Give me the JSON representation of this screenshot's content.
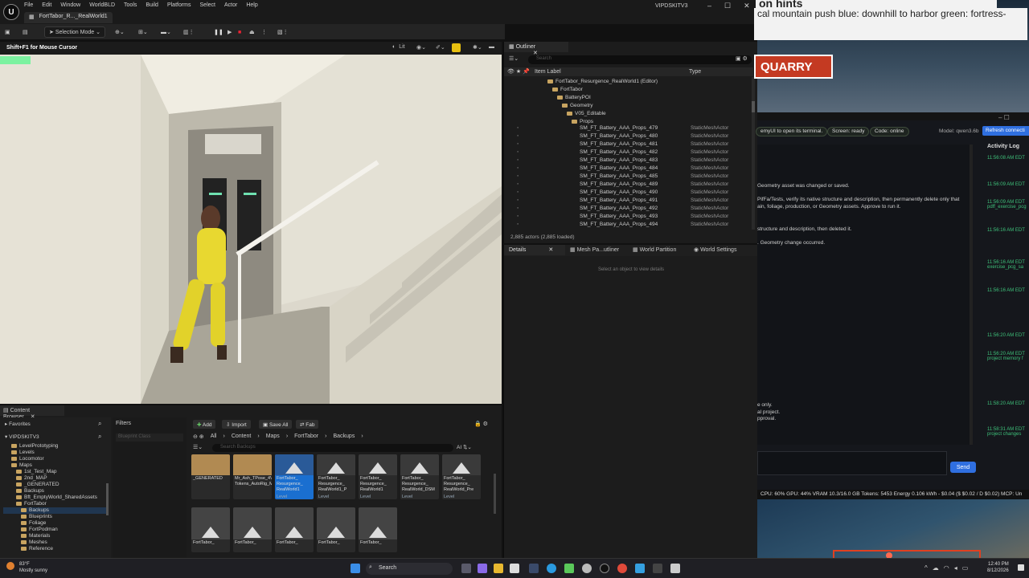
{
  "editor": {
    "menu": [
      "File",
      "Edit",
      "Window",
      "WorldBLD",
      "Tools",
      "Build",
      "Platforms",
      "Select",
      "Actor",
      "Help"
    ],
    "doc_tab": "FortTabor_R..._RealWorld1",
    "window_title": "VIPDSKITV3",
    "selection_mode": "Selection Mode",
    "viewport_hint": "Shift+F1 for Mouse Cursor",
    "viewport_lit": "Lit"
  },
  "outliner": {
    "title": "Outliner",
    "search_placeholder": "Search",
    "col_label": "Item Label",
    "col_type": "Type",
    "tree": [
      {
        "label": "FortTabor_Resurgence_RealWorld1 (Editor)",
        "indent": 52
      },
      {
        "label": "FortTabor",
        "indent": 58
      },
      {
        "label": "BatteryPOI",
        "indent": 64
      },
      {
        "label": "Geometry",
        "indent": 70
      },
      {
        "label": "V05_Editable",
        "indent": 76
      },
      {
        "label": "Props",
        "indent": 82
      }
    ],
    "items": [
      {
        "name": "SM_FT_Battery_AAA_Props_479",
        "type": "StaticMeshActor"
      },
      {
        "name": "SM_FT_Battery_AAA_Props_480",
        "type": "StaticMeshActor"
      },
      {
        "name": "SM_FT_Battery_AAA_Props_481",
        "type": "StaticMeshActor"
      },
      {
        "name": "SM_FT_Battery_AAA_Props_482",
        "type": "StaticMeshActor"
      },
      {
        "name": "SM_FT_Battery_AAA_Props_483",
        "type": "StaticMeshActor"
      },
      {
        "name": "SM_FT_Battery_AAA_Props_484",
        "type": "StaticMeshActor"
      },
      {
        "name": "SM_FT_Battery_AAA_Props_485",
        "type": "StaticMeshActor"
      },
      {
        "name": "SM_FT_Battery_AAA_Props_489",
        "type": "StaticMeshActor"
      },
      {
        "name": "SM_FT_Battery_AAA_Props_490",
        "type": "StaticMeshActor"
      },
      {
        "name": "SM_FT_Battery_AAA_Props_491",
        "type": "StaticMeshActor"
      },
      {
        "name": "SM_FT_Battery_AAA_Props_492",
        "type": "StaticMeshActor"
      },
      {
        "name": "SM_FT_Battery_AAA_Props_493",
        "type": "StaticMeshActor"
      },
      {
        "name": "SM_FT_Battery_AAA_Props_494",
        "type": "StaticMeshActor"
      }
    ],
    "status": "2,885 actors (2,885 loaded)"
  },
  "details": {
    "tabs": [
      "Details",
      "Mesh Pa...utliner",
      "World Partition",
      "World Settings"
    ],
    "empty": "Select an object to view details"
  },
  "content_browser": {
    "title": "Content Browser",
    "favorites": "Favorites",
    "root": "VIPDSKITV3",
    "filters": "Filters",
    "filter_placeholder": "Blueprint Class",
    "buttons": {
      "add": "Add",
      "import": "Import",
      "save_all": "Save All",
      "fab": "Fab"
    },
    "path": [
      "All",
      "Content",
      "Maps",
      "FortTabor",
      "Backups"
    ],
    "search_placeholder": "Search Backups",
    "tree": [
      {
        "label": "LevelPrototyping",
        "indent": 10
      },
      {
        "label": "Levels",
        "indent": 10
      },
      {
        "label": "Locomotor",
        "indent": 10
      },
      {
        "label": "Maps",
        "indent": 10
      },
      {
        "label": "1st_Test_Map",
        "indent": 16
      },
      {
        "label": "2nd_MAP",
        "indent": 16
      },
      {
        "label": "_GENERATED",
        "indent": 16
      },
      {
        "label": "Backups",
        "indent": 16
      },
      {
        "label": "Bft_EmptyWorld_SharedAssets",
        "indent": 16
      },
      {
        "label": "FortTabor",
        "indent": 16
      },
      {
        "label": "Backups",
        "indent": 22
      },
      {
        "label": "Blueprints",
        "indent": 22
      },
      {
        "label": "Foliage",
        "indent": 22
      },
      {
        "label": "FortPodman",
        "indent": 22
      },
      {
        "label": "Materials",
        "indent": 22
      },
      {
        "label": "Meshes",
        "indent": 22
      },
      {
        "label": "Reference",
        "indent": 22
      }
    ],
    "assets_row1": [
      {
        "label": "_GENERATED",
        "kind": "folder"
      },
      {
        "label": "Mr_Ash_TPose_4View_2K_Skin Tokens_AutoRig_Mixamo",
        "kind": "folder"
      },
      {
        "label": "FortTabor_ Resurgence_ RealWorld1",
        "kind": "level",
        "sub": "Level"
      },
      {
        "label": "FortTabor_ Resurgence_ RealWorld1_P",
        "kind": "level",
        "sub": "Level"
      },
      {
        "label": "FortTabor_ Resurgence_ RealWorld1",
        "kind": "level",
        "sub": "Level"
      },
      {
        "label": "FortTabor_ Resurgence_ RealWorld_DSM",
        "kind": "level",
        "sub": "Level"
      },
      {
        "label": "FortTabor_ Resurgence_ RealWorld_Pre",
        "kind": "level",
        "sub": "Level"
      }
    ],
    "assets_row2": [
      "FortTabor_",
      "FortTabor_",
      "FortTabor_",
      "FortTabor_",
      "FortTabor_"
    ]
  },
  "right_panel": {
    "hints_text": "cal mountain push   blue: downhill to harbor   green: fortress-",
    "hints_header": "on hints",
    "quarry": "QUARRY",
    "chips": [
      "emyUI to open its terminal.",
      "Screen: ready",
      "Code: online"
    ],
    "model": "Model: qwen3.6b",
    "refresh": "Refresh connecti",
    "activity_title": "Activity Log",
    "messages": [
      "Geometry asset was changed or saved.",
      "PifFa/Tests, verify its native structure and description, then permanently delete only that",
      "ain, foliage, production, or Geometry assets. Approve to run it.",
      "structure and description, then deleted it.",
      ". Geometry change occurred.",
      "e only.",
      "al project.",
      "pproval."
    ],
    "activity": [
      {
        "time": "11:56:08 AM EDT",
        "text": ""
      },
      {
        "time": "11:56:09 AM EDT",
        "text": ""
      },
      {
        "time": "11:56:09 AM EDT",
        "text": "pdff_exercise_pcg"
      },
      {
        "time": "11:56:16 AM EDT",
        "text": ""
      },
      {
        "time": "11:56:16 AM EDT",
        "text": "exercise_pcg_sa"
      },
      {
        "time": "11:56:16 AM EDT",
        "text": ""
      },
      {
        "time": "11:56:20 AM EDT",
        "text": ""
      },
      {
        "time": "11:56:20 AM EDT",
        "text": "project memory f"
      },
      {
        "time": "11:58:20 AM EDT",
        "text": ""
      },
      {
        "time": "11:58:31 AM EDT",
        "text": "project changes"
      }
    ],
    "send": "Send",
    "stats": "CPU: 60%  GPU: 44%  VRAM 10.3/16.0 GB  Tokens: 5453  Energy 0.106 kWh - $0.04 ($ $0.02 / D $0.02)  MCP: Un"
  },
  "taskbar": {
    "temp": "83°F",
    "weather": "Mostly sunny",
    "search": "Search",
    "time": "12:40 PM",
    "date": "8/12/2026"
  }
}
